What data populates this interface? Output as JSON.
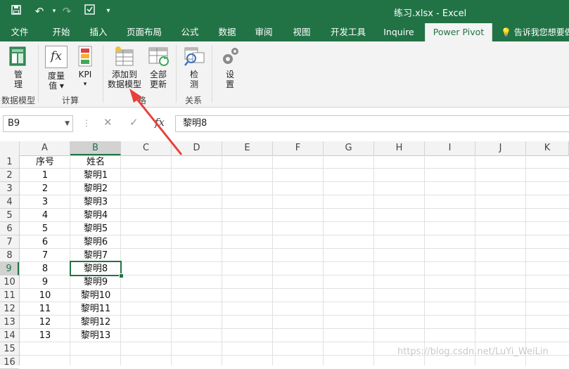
{
  "window": {
    "title": "练习.xlsx - Excel"
  },
  "quick_access": {
    "save": "save",
    "undo": "undo",
    "redo": "redo",
    "customize": "customize"
  },
  "tabs": [
    "文件",
    "开始",
    "插入",
    "页面布局",
    "公式",
    "数据",
    "审阅",
    "视图",
    "开发工具",
    "Inquire",
    "Power Pivot"
  ],
  "active_tab": "Power Pivot",
  "tell_me": "告诉我您想要做",
  "ribbon": {
    "manage": {
      "line1": "管",
      "line2": "理"
    },
    "measure": {
      "line1": "度量",
      "line2": "值 ▾"
    },
    "kpi": {
      "line1": "KPI",
      "line2": "▾"
    },
    "add_to_model": {
      "line1": "添加到",
      "line2": "数据模型"
    },
    "update_all": {
      "line1": "全部",
      "line2": "更新"
    },
    "detect": {
      "line1": "检",
      "line2": "测"
    },
    "settings": {
      "line1": "设",
      "line2": "置"
    },
    "groups": {
      "data_model": "数据模型",
      "calc": "计算",
      "tables": "格",
      "relations": "关系"
    }
  },
  "formula_bar": {
    "name_box": "B9",
    "fx": "fx",
    "value": "黎明8"
  },
  "columns": [
    "A",
    "B",
    "C",
    "D",
    "E",
    "F",
    "G",
    "H",
    "I",
    "J",
    "K"
  ],
  "rows": [
    "1",
    "2",
    "3",
    "4",
    "5",
    "6",
    "7",
    "8",
    "9",
    "10",
    "11",
    "12",
    "13",
    "14",
    "15",
    "16"
  ],
  "selected": {
    "column": "B",
    "row": "9"
  },
  "sheet": {
    "A": [
      "序号",
      "1",
      "2",
      "3",
      "4",
      "5",
      "6",
      "7",
      "8",
      "9",
      "10",
      "11",
      "12",
      "13"
    ],
    "B": [
      "姓名",
      "黎明1",
      "黎明2",
      "黎明3",
      "黎明4",
      "黎明5",
      "黎明6",
      "黎明7",
      "黎明8",
      "黎明9",
      "黎明10",
      "黎明11",
      "黎明12",
      "黎明13"
    ]
  },
  "watermark": "https://blog.csdn.net/LuYi_WeiLin",
  "colors": {
    "accent": "#217346",
    "arrow": "#e8403a"
  }
}
